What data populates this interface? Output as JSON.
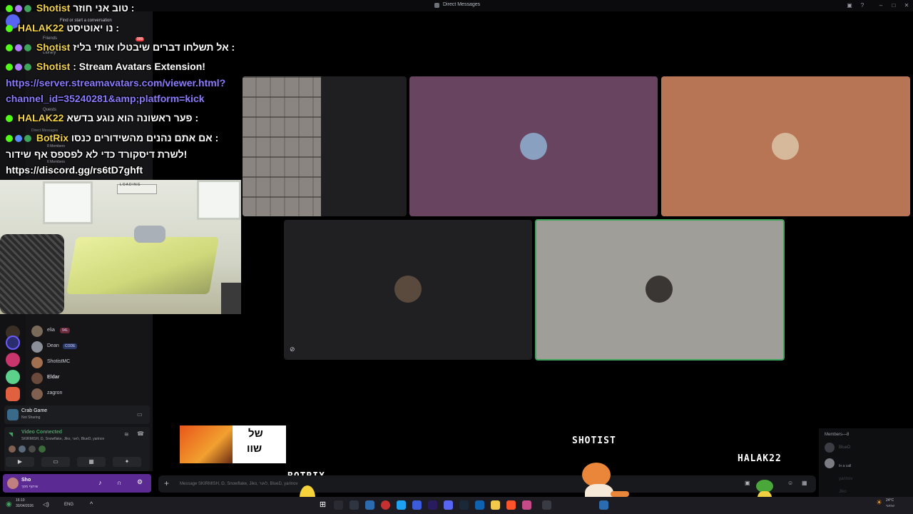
{
  "window": {
    "title": "Direct Messages"
  },
  "chat": [
    {
      "user": "Shotist",
      "msg": "טוב אני חוזר :"
    },
    {
      "user": "HALAK22",
      "msg": "נו יאוטיסט :"
    },
    {
      "user": "Shotist",
      "msg": "אל תשלחו דברים שיבטלו אותי בליז :"
    },
    {
      "user": "Shotist",
      "msg": ": Stream Avatars Extension!"
    },
    {
      "link1": "https://server.streamavatars.com/viewer.html?",
      "link2": "channel_id=35240281&amp;platform=kick"
    },
    {
      "user": "HALAK22",
      "msg": "פער ראשונה הוא נוגע בדשא :"
    },
    {
      "user": "BotRix",
      "msg": "אם אתם נהנים מהשידורים כנסו :"
    },
    {
      "msg": "לשרת דיסקורד כדי לא לפספס אף שידור!"
    },
    {
      "msg": "https://discord.gg/rs6tD7ghft"
    }
  ],
  "sidebar": {
    "search_placeholder": "Find or start a conversation",
    "friends": "Friends",
    "library": "Library",
    "quests": "Quests",
    "direct_messages": "Direct Messages",
    "unread_badge": "999",
    "dm_sub": [
      "8 Members",
      "6 Members"
    ],
    "members": [
      {
        "name": "elia",
        "tag": "94L"
      },
      {
        "name": "Dean",
        "tag": "CODE"
      },
      {
        "name": "ShotistMC",
        "tag": ""
      },
      {
        "name": "Eldar",
        "tag": ""
      },
      {
        "name": "zagron",
        "tag": ""
      }
    ],
    "activity": {
      "title": "Crab Game",
      "subtitle": "Not Sharing"
    },
    "voice": {
      "status": "Video Connected",
      "participants": "SKIRMISH, Ɒ, Snowflake, Jiko, לאור, BlueD, yarinov"
    },
    "user": {
      "name": "Sho",
      "status": "שיתוף מסך"
    }
  },
  "overlay": {
    "sign_line1": "של",
    "sign_line2": "שוו",
    "name_botrix": "BOTRIX",
    "name_shotist": "SHOTIST",
    "name_halak": "HALAK22",
    "loading": "LOADING"
  },
  "members_panel": {
    "header": "Members—8",
    "items": [
      "BlueD",
      "In a call",
      "yarinov",
      "Jiko"
    ]
  },
  "message_input": {
    "placeholder": "Message SKIRMISH, Ɒ, Snowflake, Jiko, לאור, BlueD, yarinov"
  },
  "taskbar": {
    "time": "16:10",
    "date": "30/04/2026",
    "lang": "ENG",
    "weather": "24°C",
    "weather_sub": "שמשי"
  },
  "colors": {
    "tile_purple": "#684460",
    "tile_orange": "#b77556",
    "tile_dark": "#202022",
    "tile_gray": "#a09e98",
    "speaking_border": "#3fa45c",
    "accent": "#5b2a93"
  }
}
